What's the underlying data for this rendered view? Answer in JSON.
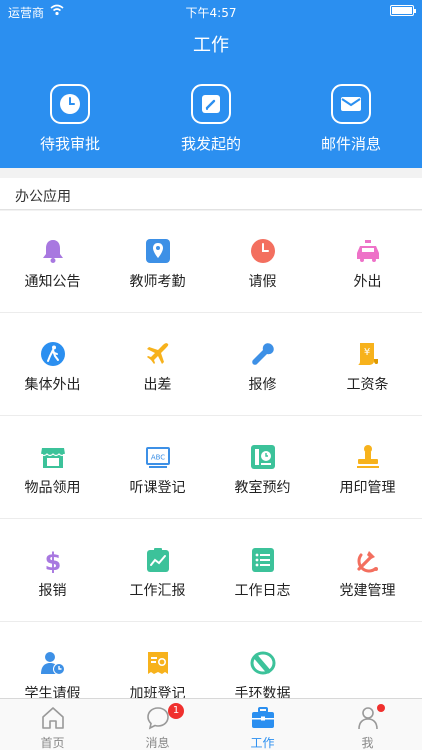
{
  "status_bar": {
    "carrier": "运营商",
    "time": "下午4:57"
  },
  "header": {
    "title": "工作",
    "quick_actions": [
      {
        "label": "待我审批",
        "icon": "clock-icon"
      },
      {
        "label": "我发起的",
        "icon": "edit-icon"
      },
      {
        "label": "邮件消息",
        "icon": "mail-icon"
      }
    ]
  },
  "section": {
    "title": "办公应用"
  },
  "apps": [
    {
      "label": "通知公告",
      "icon": "bell-icon",
      "color": "#a878e0"
    },
    {
      "label": "教师考勤",
      "icon": "location-pin-icon",
      "color": "#3d90e6"
    },
    {
      "label": "请假",
      "icon": "clock-icon",
      "color": "#f36f5f"
    },
    {
      "label": "外出",
      "icon": "taxi-icon",
      "color": "#ee72c8"
    },
    {
      "label": "集体外出",
      "icon": "walking-person-icon",
      "color": "#2b8ff0"
    },
    {
      "label": "出差",
      "icon": "airplane-icon",
      "color": "#f7b21c"
    },
    {
      "label": "报修",
      "icon": "wrench-icon",
      "color": "#3d90e6"
    },
    {
      "label": "工资条",
      "icon": "salary-scroll-icon",
      "color": "#f7b21c"
    },
    {
      "label": "物品领用",
      "icon": "shop-icon",
      "color": "#3cc29a"
    },
    {
      "label": "听课登记",
      "icon": "blackboard-abc-icon",
      "color": "#3d90e6"
    },
    {
      "label": "教室预约",
      "icon": "classroom-booking-icon",
      "color": "#3cc29a"
    },
    {
      "label": "用印管理",
      "icon": "stamp-icon",
      "color": "#f7b21c"
    },
    {
      "label": "报销",
      "icon": "dollar-icon",
      "color": "#a878e0"
    },
    {
      "label": "工作汇报",
      "icon": "report-chart-icon",
      "color": "#3cc29a"
    },
    {
      "label": "工作日志",
      "icon": "list-log-icon",
      "color": "#3cc29a"
    },
    {
      "label": "党建管理",
      "icon": "party-emblem-icon",
      "color": "#f36f5f"
    },
    {
      "label": "学生请假",
      "icon": "student-clock-icon",
      "color": "#3d90e6"
    },
    {
      "label": "加班登记",
      "icon": "overtime-receipt-icon",
      "color": "#f7b21c"
    },
    {
      "label": "手环数据",
      "icon": "wristband-icon",
      "color": "#3cc29a"
    }
  ],
  "tabbar": {
    "tabs": [
      {
        "label": "首页",
        "icon": "home-icon",
        "active": false
      },
      {
        "label": "消息",
        "icon": "message-icon",
        "active": false,
        "badge": "1"
      },
      {
        "label": "工作",
        "icon": "briefcase-icon",
        "active": true
      },
      {
        "label": "我",
        "icon": "person-icon",
        "active": false,
        "dot": true
      }
    ]
  },
  "colors": {
    "primary": "#2b8ff0",
    "badge": "#f0302e"
  }
}
